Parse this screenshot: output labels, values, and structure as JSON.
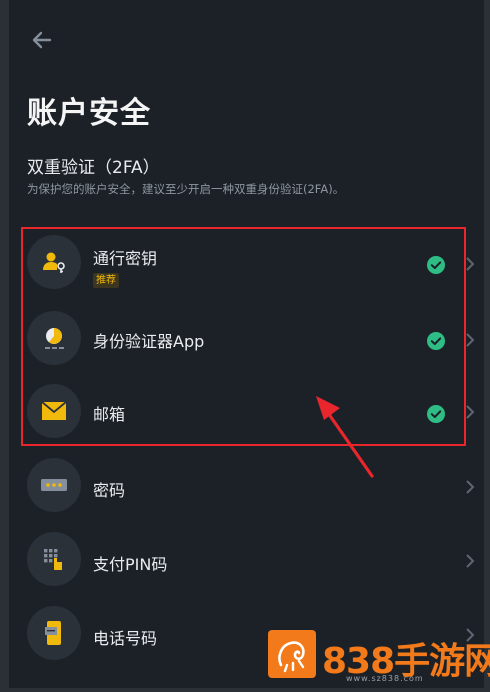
{
  "header": {
    "title": "账户安全"
  },
  "section": {
    "title": "双重验证（2FA）",
    "description": "为保护您的账户安全，建议至少开启一种双重身份验证(2FA)。"
  },
  "items": [
    {
      "label": "通行密钥",
      "tag": "推荐",
      "icon": "passkey-icon",
      "enabled": true
    },
    {
      "label": "身份验证器App",
      "icon": "authenticator-icon",
      "enabled": true
    },
    {
      "label": "邮箱",
      "icon": "email-icon",
      "enabled": true
    },
    {
      "label": "密码",
      "icon": "password-icon",
      "enabled": false
    },
    {
      "label": "支付PIN码",
      "icon": "pin-icon",
      "enabled": false
    },
    {
      "label": "电话号码",
      "icon": "phone-icon",
      "enabled": false
    }
  ],
  "colors": {
    "background": "#1c2127",
    "card": "#2b3139",
    "accent": "#f0b90b",
    "success": "#2ebd85",
    "annotation": "#e8262c"
  },
  "watermark": {
    "text": "838手游网",
    "sub": "www.sz838.com"
  }
}
